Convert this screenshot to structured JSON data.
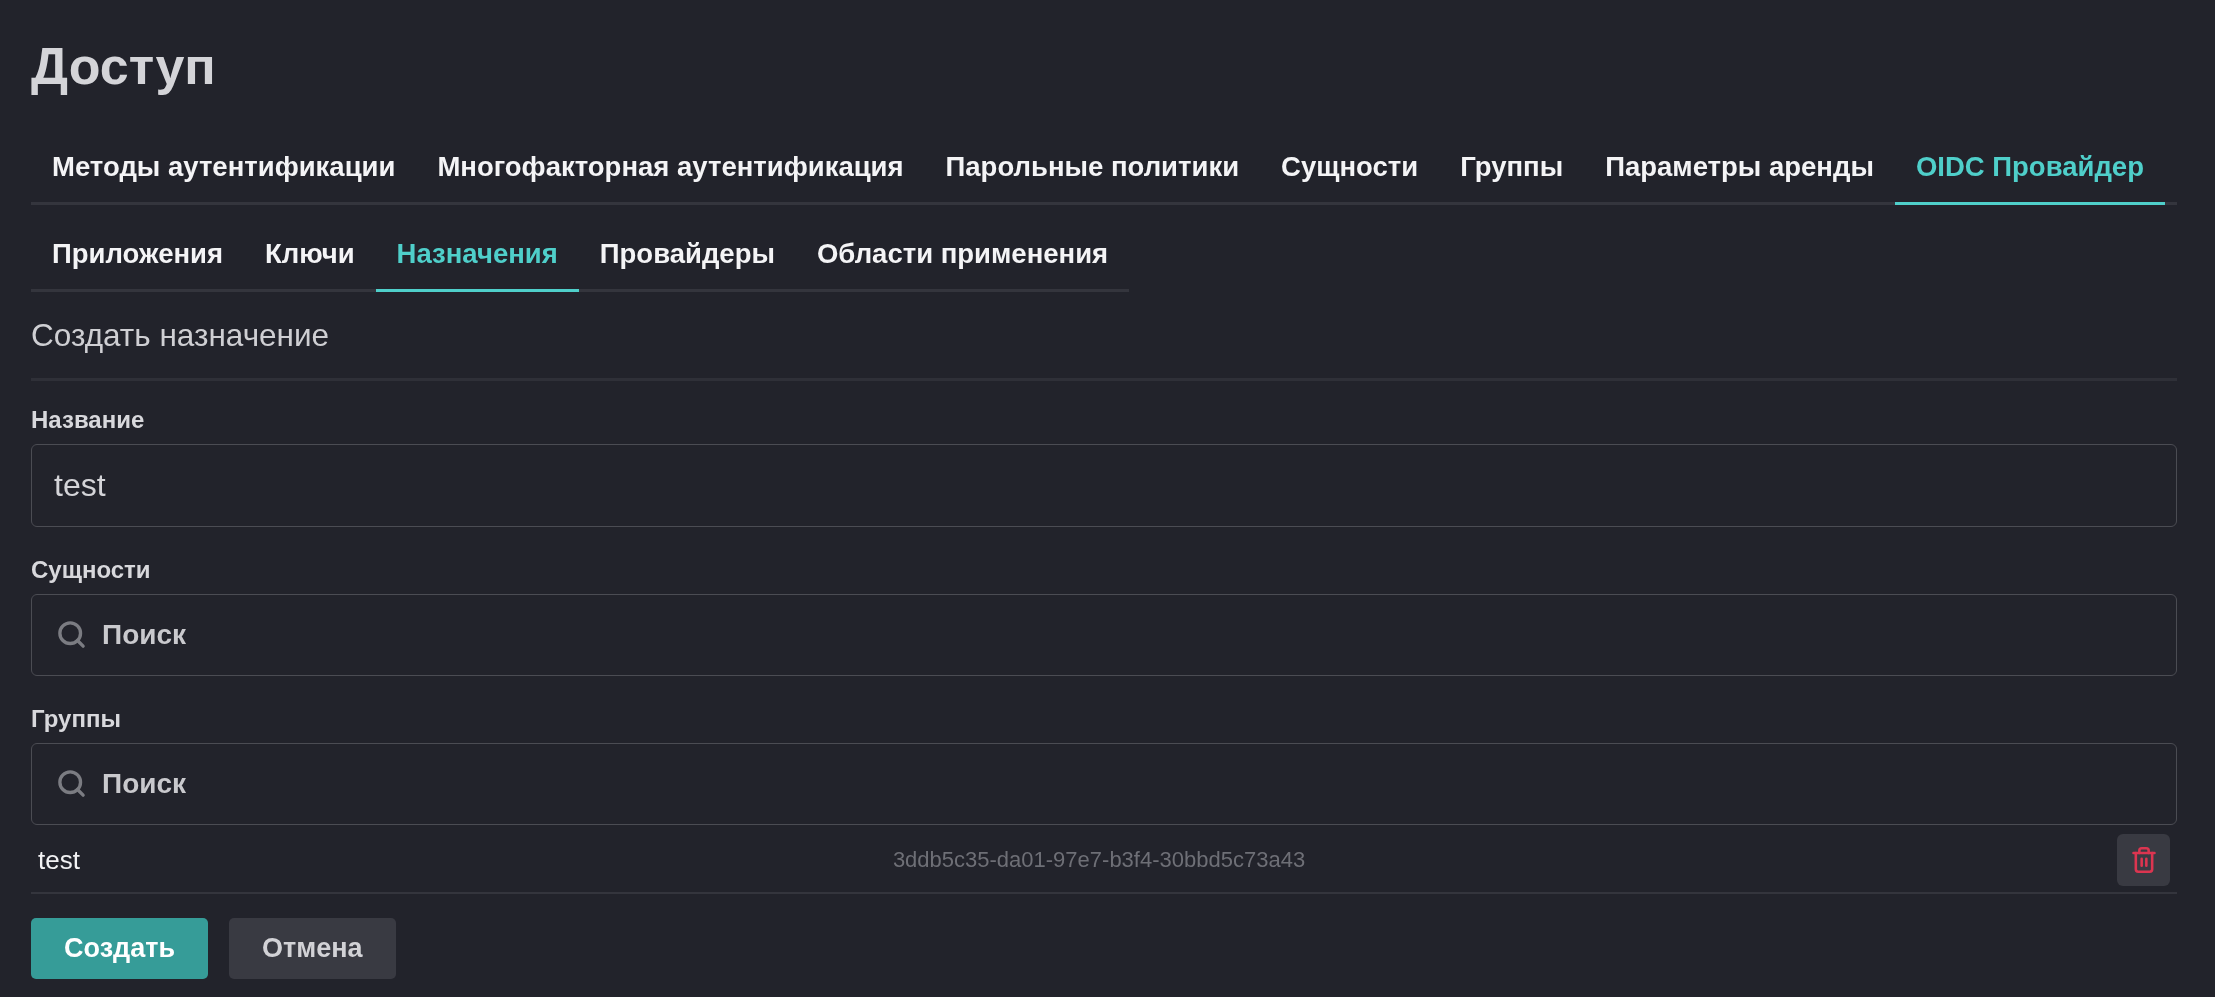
{
  "page": {
    "title": "Доступ"
  },
  "tabs": [
    {
      "label": "Методы аутентификации",
      "selected": false
    },
    {
      "label": "Многофакторная аутентификация",
      "selected": false
    },
    {
      "label": "Парольные политики",
      "selected": false
    },
    {
      "label": "Сущности",
      "selected": false
    },
    {
      "label": "Группы",
      "selected": false
    },
    {
      "label": "Параметры аренды",
      "selected": false
    },
    {
      "label": "OIDC Провайдер",
      "selected": true
    }
  ],
  "subtabs": [
    {
      "label": "Приложения",
      "selected": false
    },
    {
      "label": "Ключи",
      "selected": false
    },
    {
      "label": "Назначения",
      "selected": true
    },
    {
      "label": "Провайдеры",
      "selected": false
    },
    {
      "label": "Области применения",
      "selected": false
    }
  ],
  "form": {
    "title": "Создать назначение",
    "fields": [
      {
        "kind": "text",
        "label": "Название",
        "value": "test"
      },
      {
        "kind": "search",
        "label": "Сущности",
        "placeholder": "Поиск"
      },
      {
        "kind": "search",
        "label": "Группы",
        "placeholder": "Поиск",
        "items": [
          {
            "name": "test",
            "uuid": "3ddb5c35-da01-97e7-b3f4-30bbd5c73a43"
          }
        ]
      }
    ],
    "buttons": [
      {
        "kind": "primary",
        "label": "Создать"
      },
      {
        "kind": "secondary",
        "label": "Отмена"
      }
    ]
  }
}
